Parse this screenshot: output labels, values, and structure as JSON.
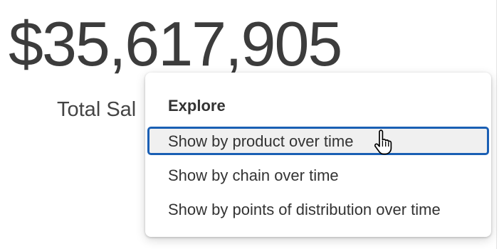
{
  "kpi": {
    "value": "$35,617,905",
    "label": "Total Sal"
  },
  "menu": {
    "heading": "Explore",
    "items": [
      {
        "label": "Show by product over time",
        "active": true
      },
      {
        "label": "Show by chain over time",
        "active": false
      },
      {
        "label": "Show by points of distribution over time",
        "active": false
      }
    ]
  },
  "colors": {
    "focus_outline": "#1a5fb4",
    "hover_background": "#f0f0f0",
    "text": "#333333"
  },
  "icons": {
    "cursor": "hand-pointer-icon"
  }
}
